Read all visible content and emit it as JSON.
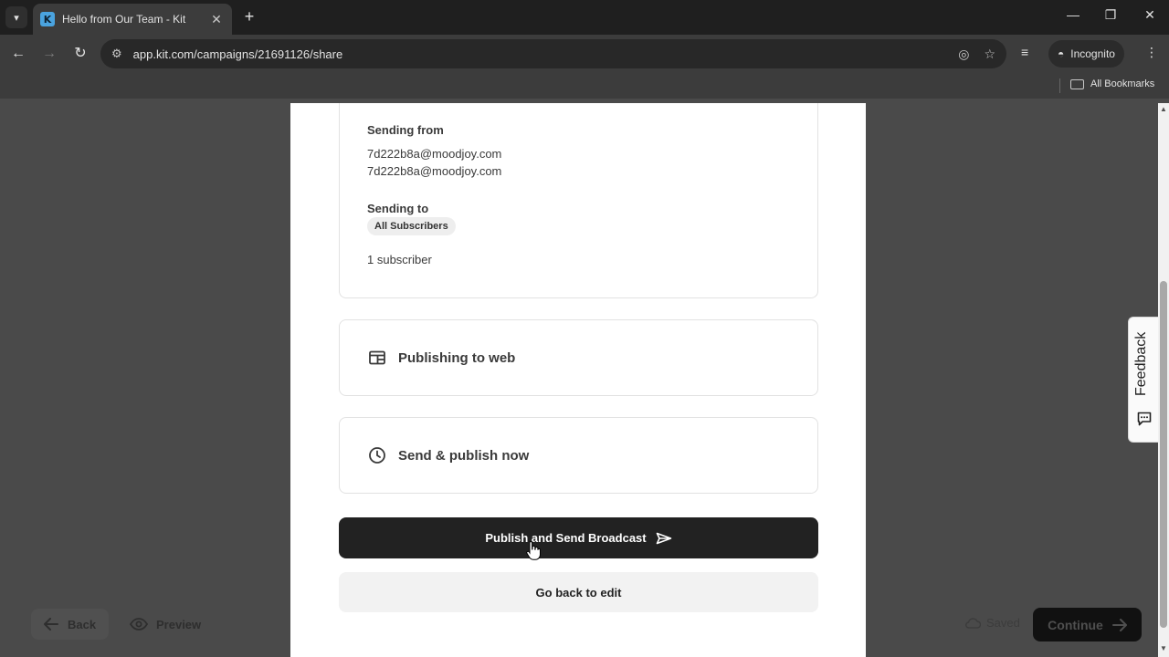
{
  "browser": {
    "tab_title": "Hello from Our Team - Kit",
    "favicon_letter": "K",
    "url": "app.kit.com/campaigns/21691126/share",
    "incognito_label": "Incognito",
    "bookmarks_label": "All Bookmarks"
  },
  "details": {
    "sending_from_label": "Sending from",
    "from_email_1": "7d222b8a@moodjoy.com",
    "from_email_2": "7d222b8a@moodjoy.com",
    "sending_to_label": "Sending to",
    "segment_pill": "All Subscribers",
    "subscriber_count": "1 subscriber"
  },
  "options": {
    "publishing_label": "Publishing to web",
    "send_label": "Send & publish now"
  },
  "actions": {
    "publish_send_label": "Publish and Send Broadcast",
    "go_back_label": "Go back to edit"
  },
  "footer": {
    "back_label": "Back",
    "preview_label": "Preview",
    "saved_label": "Saved",
    "continue_label": "Continue"
  },
  "feedback": {
    "label": "Feedback"
  },
  "colors": {
    "primary_button": "#222222",
    "overlay_background": "#4a4a4a",
    "browser_chrome": "#3c3c3c"
  }
}
